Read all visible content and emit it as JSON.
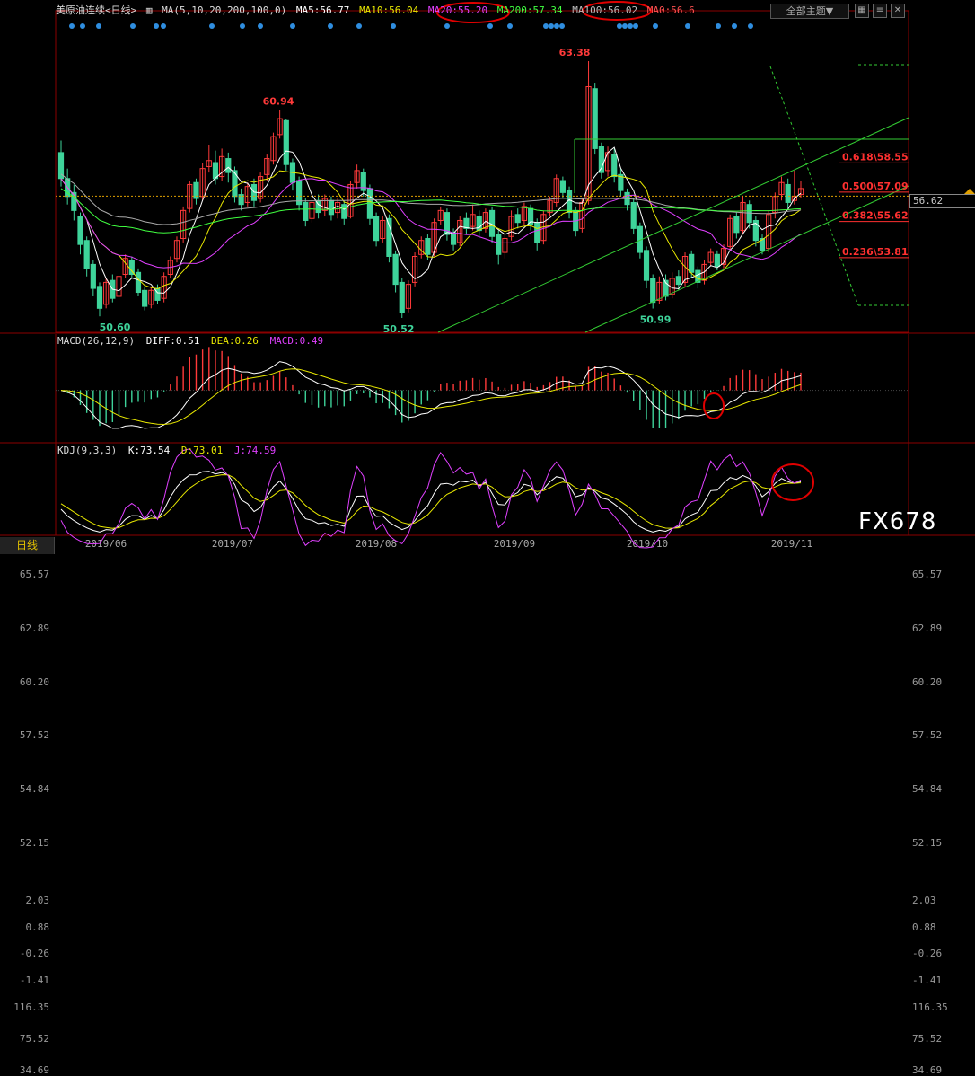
{
  "header": {
    "title": "美原油连续<日线>",
    "ma_params": "MA(5,10,20,200,100,0)",
    "ma5": "MA5:56.77",
    "ma10": "MA10:56.04",
    "ma20": "MA20:55.20",
    "ma200": "MA200:57.34",
    "ma100": "MA100:56.02",
    "ma0": "MA0:56.6",
    "theme_dropdown": "全部主题▼",
    "period_tab": "日线",
    "current_price": "56.62"
  },
  "macd_header": {
    "params": "MACD(26,12,9)",
    "diff": "DIFF:0.51",
    "dea": "DEA:0.26",
    "macd": "MACD:0.49"
  },
  "kdj_header": {
    "params": "KDJ(9,3,3)",
    "k": "K:73.54",
    "d": "D:73.01",
    "j": "J:74.59"
  },
  "watermark": "FX678",
  "colors": {
    "up": "#ff3a3a",
    "down": "#3ed39a",
    "ma5": "#ffffff",
    "ma10": "#e8e800",
    "ma20": "#e040ff",
    "ma200": "#aaaaaa",
    "ma100": "#40ff40",
    "fib": "#ff3030",
    "trend": "#33cc33"
  },
  "chart_data": {
    "type": "candlestick",
    "price_axis_ticks": [
      65.57,
      62.89,
      60.2,
      57.52,
      54.84,
      52.15
    ],
    "macd_axis_ticks": [
      2.03,
      0.88,
      -0.26,
      -1.41
    ],
    "kdj_axis_ticks": [
      116.35,
      75.52,
      34.69
    ],
    "x_labels": [
      "2019/06",
      "2019/07",
      "2019/08",
      "2019/09",
      "2019/10",
      "2019/11"
    ],
    "annotations": [
      "50.60",
      "60.94",
      "50.52",
      "63.38",
      "50.99"
    ],
    "fibonacci": [
      "0.618\\58.55",
      "0.500\\57.09",
      "0.382\\55.62",
      "0.236\\53.81"
    ],
    "candles": [
      [
        58.8,
        57.5,
        59.4,
        57.1
      ],
      [
        57.5,
        56.6,
        58.0,
        56.2
      ],
      [
        56.8,
        55.9,
        57.2,
        55.4
      ],
      [
        55.6,
        54.2,
        55.8,
        53.7
      ],
      [
        54.4,
        53.0,
        54.6,
        52.6
      ],
      [
        53.2,
        52.0,
        53.4,
        51.6
      ],
      [
        52.1,
        51.0,
        52.3,
        50.6
      ],
      [
        51.2,
        52.3,
        52.5,
        51.0
      ],
      [
        52.4,
        51.5,
        52.7,
        51.3
      ],
      [
        51.6,
        52.6,
        52.8,
        51.4
      ],
      [
        52.7,
        53.5,
        53.7,
        52.5
      ],
      [
        53.4,
        52.7,
        53.6,
        52.5
      ],
      [
        52.8,
        51.8,
        53.0,
        51.6
      ],
      [
        51.9,
        51.1,
        52.1,
        50.9
      ],
      [
        51.2,
        51.9,
        52.1,
        51.0
      ],
      [
        52.0,
        51.4,
        52.2,
        51.2
      ],
      [
        51.5,
        52.6,
        52.8,
        51.3
      ],
      [
        52.7,
        53.4,
        53.6,
        52.5
      ],
      [
        53.5,
        54.4,
        54.6,
        53.3
      ],
      [
        54.5,
        55.9,
        56.1,
        54.3
      ],
      [
        56.0,
        57.2,
        57.4,
        55.8
      ],
      [
        57.3,
        56.5,
        57.5,
        56.2
      ],
      [
        56.6,
        58.0,
        58.3,
        56.4
      ],
      [
        58.1,
        58.4,
        59.2,
        57.8
      ],
      [
        58.3,
        57.5,
        58.9,
        57.2
      ],
      [
        57.6,
        58.6,
        59.0,
        57.4
      ],
      [
        58.5,
        57.8,
        58.8,
        57.3
      ],
      [
        57.9,
        56.6,
        58.1,
        56.3
      ],
      [
        56.7,
        56.2,
        57.0,
        55.9
      ],
      [
        56.3,
        57.1,
        57.3,
        56.1
      ],
      [
        57.2,
        56.4,
        57.5,
        56.1
      ],
      [
        56.5,
        57.6,
        57.8,
        56.3
      ],
      [
        57.7,
        58.5,
        58.7,
        57.4
      ],
      [
        58.4,
        59.6,
        59.8,
        58.2
      ],
      [
        59.7,
        60.5,
        60.94,
        59.5
      ],
      [
        60.4,
        58.2,
        60.5,
        57.9
      ],
      [
        58.3,
        57.3,
        58.5,
        56.9
      ],
      [
        57.4,
        56.2,
        57.6,
        55.9
      ],
      [
        56.3,
        55.4,
        56.5,
        55.1
      ],
      [
        55.5,
        56.3,
        56.5,
        55.3
      ],
      [
        56.4,
        55.8,
        56.7,
        55.5
      ],
      [
        55.9,
        56.5,
        56.7,
        55.6
      ],
      [
        56.4,
        55.7,
        56.6,
        55.4
      ],
      [
        55.8,
        56.3,
        56.5,
        55.5
      ],
      [
        56.2,
        55.5,
        56.4,
        55.2
      ],
      [
        55.6,
        57.2,
        57.4,
        55.5
      ],
      [
        57.3,
        57.9,
        58.2,
        57.0
      ],
      [
        57.8,
        56.9,
        58.0,
        56.6
      ],
      [
        57.0,
        55.5,
        57.2,
        55.2
      ],
      [
        55.6,
        54.4,
        55.8,
        54.1
      ],
      [
        54.5,
        55.4,
        55.6,
        54.3
      ],
      [
        55.5,
        53.6,
        55.7,
        53.3
      ],
      [
        53.7,
        52.2,
        53.9,
        51.8
      ],
      [
        52.3,
        50.8,
        52.5,
        50.52
      ],
      [
        51.0,
        52.2,
        52.4,
        50.8
      ],
      [
        52.3,
        53.6,
        53.8,
        52.1
      ],
      [
        53.7,
        54.4,
        54.6,
        53.5
      ],
      [
        54.5,
        53.7,
        54.7,
        53.4
      ],
      [
        53.8,
        55.3,
        55.5,
        53.6
      ],
      [
        55.4,
        55.9,
        56.1,
        55.2
      ],
      [
        55.8,
        54.7,
        56.0,
        54.4
      ],
      [
        54.8,
        54.2,
        55.0,
        53.9
      ],
      [
        54.3,
        55.4,
        55.6,
        54.1
      ],
      [
        55.5,
        55.0,
        55.8,
        54.7
      ],
      [
        55.1,
        55.7,
        56.2,
        54.9
      ],
      [
        55.6,
        54.9,
        55.9,
        54.6
      ],
      [
        55.0,
        55.8,
        56.0,
        54.8
      ],
      [
        55.9,
        54.6,
        56.1,
        54.3
      ],
      [
        54.7,
        53.7,
        54.9,
        53.2
      ],
      [
        53.8,
        54.5,
        54.7,
        53.5
      ],
      [
        54.6,
        55.6,
        55.9,
        54.4
      ],
      [
        55.7,
        55.3,
        56.0,
        55.0
      ],
      [
        55.4,
        56.1,
        56.3,
        55.2
      ],
      [
        56.0,
        55.2,
        56.2,
        54.9
      ],
      [
        55.3,
        54.3,
        55.5,
        53.9
      ],
      [
        54.4,
        55.7,
        55.9,
        54.2
      ],
      [
        55.8,
        56.4,
        56.6,
        55.6
      ],
      [
        56.3,
        57.5,
        57.7,
        56.1
      ],
      [
        57.4,
        56.8,
        57.6,
        56.5
      ],
      [
        56.9,
        55.8,
        57.1,
        55.5
      ],
      [
        55.9,
        54.9,
        56.1,
        54.6
      ],
      [
        55.0,
        56.3,
        56.5,
        54.8
      ],
      [
        56.4,
        62.1,
        63.38,
        56.2
      ],
      [
        62.0,
        59.0,
        62.3,
        58.7
      ],
      [
        59.1,
        57.8,
        59.3,
        57.5
      ],
      [
        57.9,
        58.8,
        59.1,
        57.6
      ],
      [
        58.7,
        57.6,
        59.0,
        57.3
      ],
      [
        57.7,
        56.9,
        58.0,
        56.6
      ],
      [
        56.8,
        56.2,
        57.0,
        55.9
      ],
      [
        56.3,
        55.0,
        56.5,
        54.7
      ],
      [
        55.1,
        53.8,
        55.3,
        53.5
      ],
      [
        53.9,
        52.4,
        54.1,
        52.0
      ],
      [
        52.5,
        51.3,
        52.7,
        50.99
      ],
      [
        51.4,
        52.3,
        52.6,
        51.2
      ],
      [
        52.4,
        51.6,
        52.7,
        51.4
      ],
      [
        51.7,
        52.5,
        52.8,
        51.5
      ],
      [
        52.6,
        52.2,
        52.9,
        51.9
      ],
      [
        52.3,
        53.6,
        53.8,
        52.1
      ],
      [
        53.7,
        52.8,
        53.9,
        52.5
      ],
      [
        52.9,
        52.3,
        53.1,
        52.0
      ],
      [
        52.4,
        53.2,
        53.4,
        52.2
      ],
      [
        53.3,
        53.8,
        54.0,
        53.1
      ],
      [
        53.7,
        53.1,
        53.9,
        52.9
      ],
      [
        53.2,
        54.0,
        54.2,
        53.0
      ],
      [
        54.1,
        55.5,
        55.7,
        53.9
      ],
      [
        55.6,
        54.8,
        55.8,
        54.5
      ],
      [
        54.9,
        56.3,
        56.6,
        54.7
      ],
      [
        56.2,
        55.3,
        56.4,
        55.0
      ],
      [
        55.4,
        54.4,
        55.6,
        54.1
      ],
      [
        54.5,
        53.9,
        54.7,
        53.7
      ],
      [
        54.0,
        55.7,
        55.9,
        53.8
      ],
      [
        55.8,
        56.6,
        56.8,
        55.5
      ],
      [
        56.7,
        57.3,
        57.6,
        56.4
      ],
      [
        57.2,
        56.3,
        57.5,
        56.0
      ],
      [
        56.4,
        56.6,
        57.9,
        56.2
      ],
      [
        56.7,
        57.0,
        57.4,
        56.5
      ]
    ]
  }
}
